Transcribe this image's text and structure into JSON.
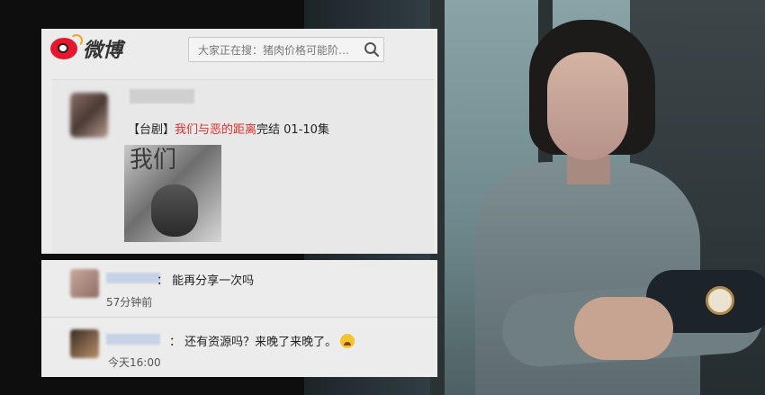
{
  "app": {
    "logo_text": "微博",
    "brand_color": "#e6162d"
  },
  "search": {
    "placeholder": "大家正在搜：猪肉价格可能阶…",
    "icon": "search-icon"
  },
  "post": {
    "tag": "【台剧】",
    "title": "我们与恶的距离",
    "suffix": "完结 01-10集",
    "title_color": "#e0322c",
    "image_poster_text": "我们"
  },
  "comments": [
    {
      "text": "：  能再分享一次吗",
      "time": "57分钟前"
    },
    {
      "text": "：  还有资源吗？来晚了来晚了。",
      "time": "今天16:00",
      "emoji": "crying-face-icon"
    }
  ]
}
